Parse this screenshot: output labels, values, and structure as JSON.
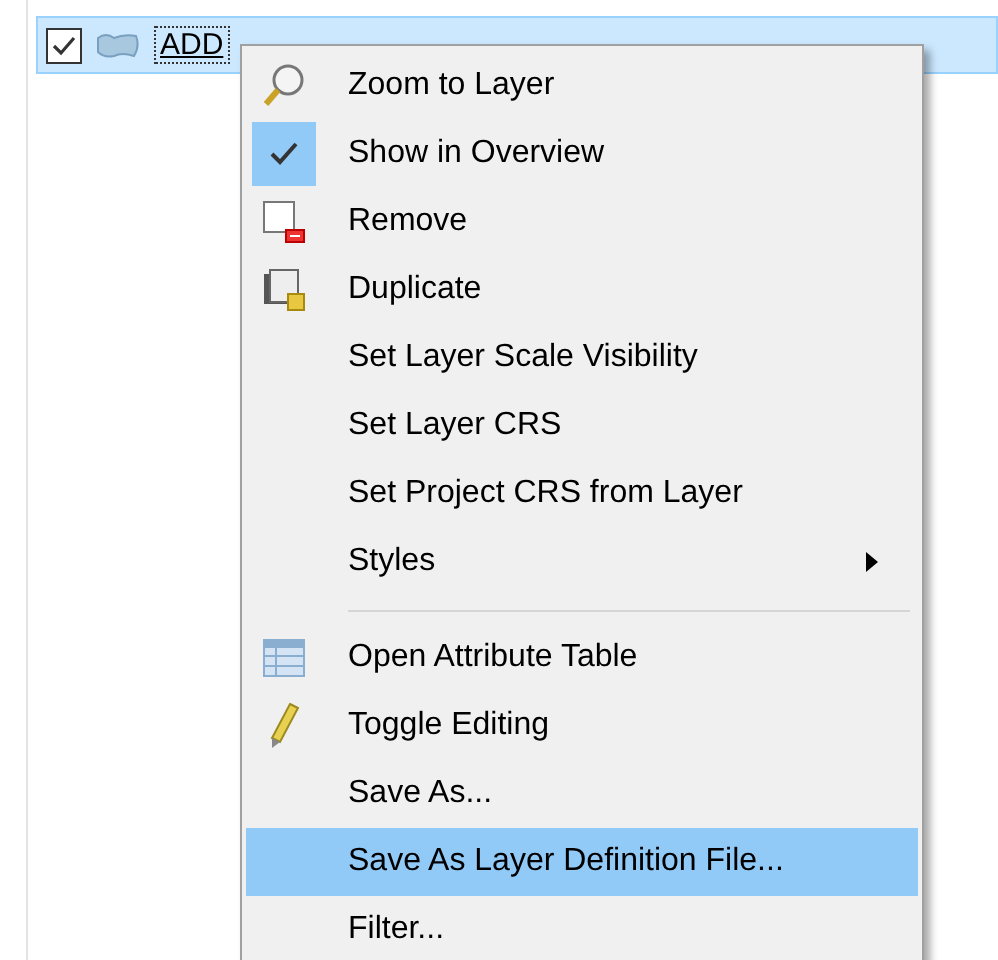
{
  "layer_row": {
    "checked": true,
    "selected": true,
    "label": "ADD"
  },
  "context_menu": {
    "items": [
      {
        "kind": "zoom",
        "label": "Zoom to Layer",
        "selected": false
      },
      {
        "kind": "check",
        "label": "Show in Overview",
        "checked": true,
        "selected": false
      },
      {
        "kind": "remove",
        "label": "Remove",
        "selected": false
      },
      {
        "kind": "duplicate",
        "label": "Duplicate",
        "selected": false
      },
      {
        "kind": "plain",
        "label": "Set Layer Scale Visibility",
        "selected": false
      },
      {
        "kind": "plain",
        "label": "Set Layer CRS",
        "selected": false
      },
      {
        "kind": "plain",
        "label": "Set Project CRS from Layer",
        "selected": false
      },
      {
        "kind": "submenu",
        "label": "Styles",
        "selected": false
      },
      {
        "kind": "separator"
      },
      {
        "kind": "table",
        "label": "Open Attribute Table",
        "selected": false
      },
      {
        "kind": "pencil",
        "label": "Toggle Editing",
        "selected": false
      },
      {
        "kind": "plain",
        "label": "Save As...",
        "selected": false
      },
      {
        "kind": "plain",
        "label": "Save As Layer Definition File...",
        "selected": true
      },
      {
        "kind": "plain",
        "label": "Filter...",
        "selected": false
      }
    ]
  }
}
